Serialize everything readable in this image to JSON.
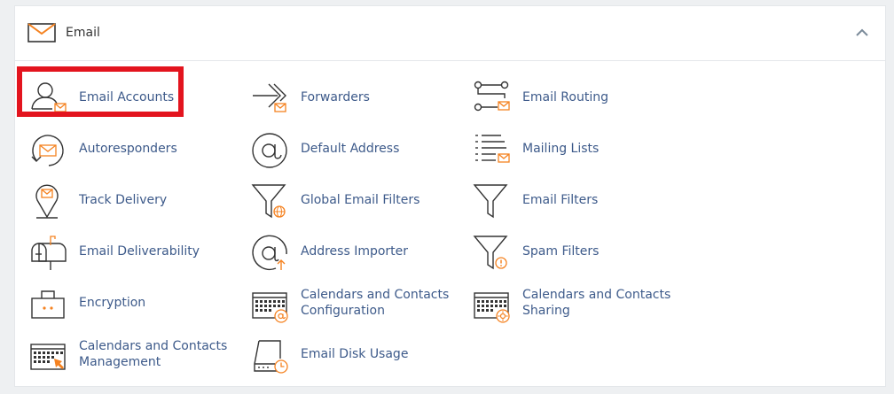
{
  "section": {
    "title": "Email",
    "icon": "envelope-icon",
    "collapse_icon": "chevron-up-icon"
  },
  "colors": {
    "accent": "#f58220",
    "link": "#3d5a8a",
    "highlight": "#e3141e",
    "icon_stroke": "#333333"
  },
  "items": [
    {
      "label": "Email Accounts",
      "icon": "user-mail-icon",
      "highlighted": true
    },
    {
      "label": "Forwarders",
      "icon": "forward-arrows-icon"
    },
    {
      "label": "Email Routing",
      "icon": "routing-icon"
    },
    {
      "label": "Autoresponders",
      "icon": "autoresponder-icon"
    },
    {
      "label": "Default Address",
      "icon": "at-sign-icon"
    },
    {
      "label": "Mailing Lists",
      "icon": "mailing-list-icon"
    },
    {
      "label": "Track Delivery",
      "icon": "location-pin-icon"
    },
    {
      "label": "Global Email Filters",
      "icon": "global-filter-icon"
    },
    {
      "label": "Email Filters",
      "icon": "funnel-icon"
    },
    {
      "label": "Email Deliverability",
      "icon": "mailbox-icon"
    },
    {
      "label": "Address Importer",
      "icon": "at-import-icon"
    },
    {
      "label": "Spam Filters",
      "icon": "spam-filter-icon"
    },
    {
      "label": "Encryption",
      "icon": "briefcase-icon"
    },
    {
      "label": "Calendars and Contacts Configuration",
      "icon": "calendar-at-icon"
    },
    {
      "label": "Calendars and Contacts Sharing",
      "icon": "calendar-share-icon"
    },
    {
      "label": "Calendars and Contacts Management",
      "icon": "calendar-manage-icon"
    },
    {
      "label": "Email Disk Usage",
      "icon": "disk-usage-icon"
    }
  ]
}
